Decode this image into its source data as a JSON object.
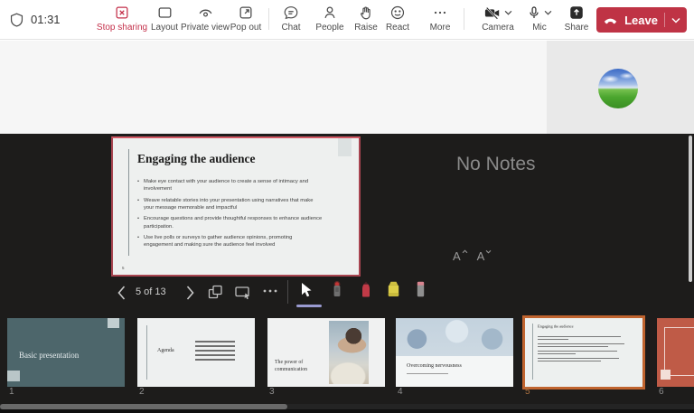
{
  "meeting": {
    "timer": "01:31",
    "toolbar": [
      {
        "label": "Stop sharing"
      },
      {
        "label": "Layout"
      },
      {
        "label": "Private view"
      },
      {
        "label": "Pop out"
      },
      {
        "label": "Chat"
      },
      {
        "label": "People"
      },
      {
        "label": "Raise"
      },
      {
        "label": "React"
      },
      {
        "label": "More"
      },
      {
        "label": "Camera"
      },
      {
        "label": "Mic"
      },
      {
        "label": "Share"
      }
    ],
    "leave_label": "Leave"
  },
  "presenter_view": {
    "notes_placeholder": "No Notes",
    "font_size_controls": {
      "increase": "A",
      "decrease": "A"
    },
    "navigation": {
      "position": "5 of 13"
    },
    "tools": [
      "select",
      "laser-pointer",
      "pen",
      "highlighter",
      "eraser"
    ],
    "active_tool": "select",
    "slide": {
      "title": "Engaging the audience",
      "bullets": [
        "Make eye contact with your audience to create a sense of intimacy and involvement",
        "Weave relatable stories into your presentation using narratives that make your message memorable and impactful",
        "Encourage questions and provide thoughtful responses to enhance audience participation.",
        "Use live polls or surveys to gather audience opinions, promoting engagement and making sure the audience feel involved"
      ],
      "page_number": "5"
    }
  },
  "filmstrip": {
    "thumbnails": [
      {
        "number": "1",
        "title": "Basic presentation",
        "selected": false
      },
      {
        "number": "2",
        "title": "Agenda",
        "selected": false
      },
      {
        "number": "3",
        "title": "The power of communication",
        "selected": false
      },
      {
        "number": "4",
        "title": "Overcoming nervousness",
        "selected": false
      },
      {
        "number": "5",
        "title": "Engaging the audience",
        "selected": true
      },
      {
        "number": "6",
        "title": "",
        "selected": false
      }
    ]
  },
  "colors": {
    "accent_red": "#C4314B",
    "leave_button": "#BF3345",
    "stage_background": "#1D1C1B",
    "slide_highlight_border": "#A84550",
    "thumbnail_selected_border": "#C0642F",
    "active_tool_underline": "#9A9BD1"
  }
}
